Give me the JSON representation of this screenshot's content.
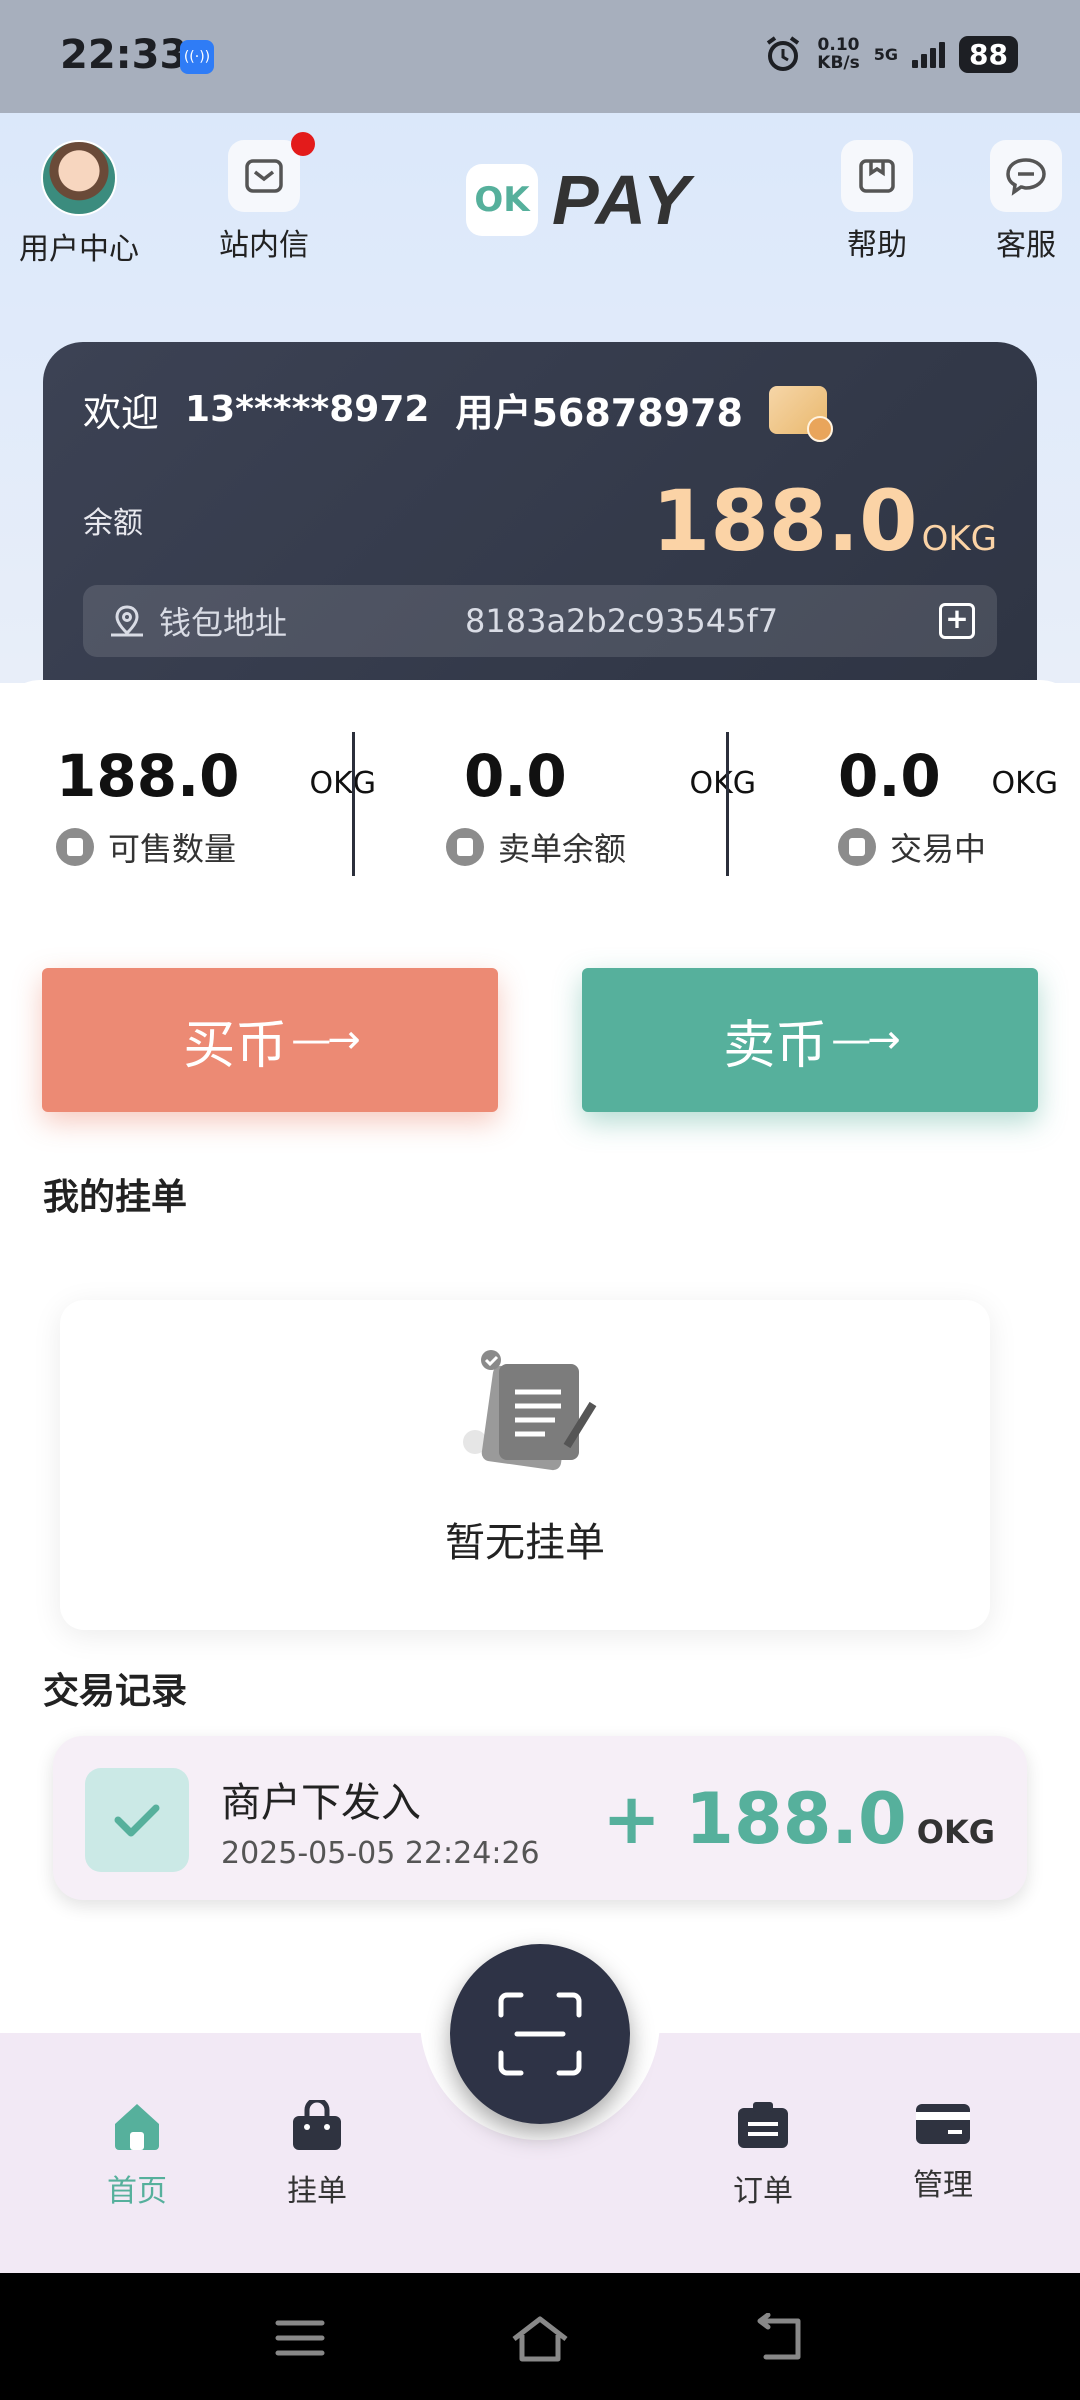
{
  "status_bar": {
    "time": "22:33",
    "app_icon": "hotspot-icon",
    "net_speed": "0.10",
    "net_unit": "KB/s",
    "network": "5G",
    "battery": "88"
  },
  "header": {
    "user_center": "用户中心",
    "messages": "站内信",
    "logo_mark": "OK",
    "logo_text": "PAY",
    "help": "帮助",
    "support": "客服"
  },
  "wallet": {
    "welcome": "欢迎",
    "phone": "13*****8972",
    "user_id": "用户56878978",
    "balance_label": "余额",
    "balance": "188.0",
    "balance_unit": "OKG",
    "address_label": "钱包地址",
    "address": "8183a2b2c93545f7"
  },
  "stats": [
    {
      "value": "188.0",
      "unit": "OKG",
      "label": "可售数量"
    },
    {
      "value": "0.0",
      "unit": "OKG",
      "label": "卖单余额"
    },
    {
      "value": "0.0",
      "unit": "OKG",
      "label": "交易中"
    }
  ],
  "actions": {
    "buy": "买币",
    "sell": "卖币",
    "arrow": "—→"
  },
  "my_orders": {
    "title": "我的挂单",
    "empty_text": "暂无挂单"
  },
  "transactions": {
    "title": "交易记录",
    "items": [
      {
        "title": "商户下发入",
        "time": "2025-05-05 22:24:26",
        "amount": "+ 188.0",
        "unit": "OKG"
      }
    ]
  },
  "bottom_nav": {
    "home": "首页",
    "listings": "挂单",
    "orders": "订单",
    "manage": "管理"
  },
  "colors": {
    "buy": "#ec8a74",
    "sell": "#56b09c",
    "card": "#363c4d",
    "balance": "#fbd3a6"
  }
}
